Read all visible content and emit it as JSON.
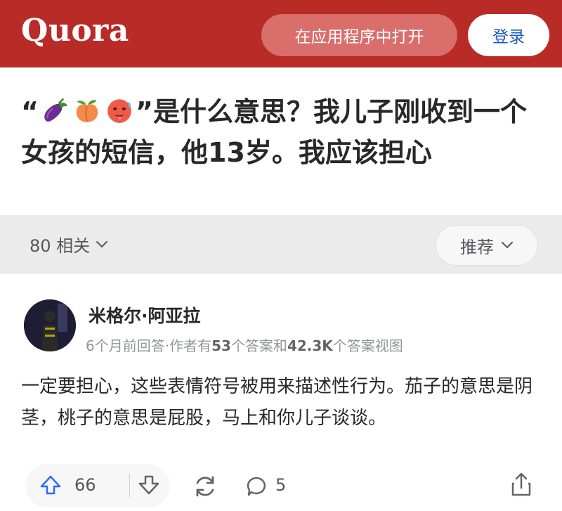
{
  "header": {
    "logo": "Quora",
    "open_in_app": "在应用程序中打开",
    "login": "登录",
    "brand_color": "#b92b27"
  },
  "question": {
    "open_quote": "“",
    "emojis": [
      "eggplant-emoji",
      "peach-emoji",
      "hot-face-emoji"
    ],
    "title_text": "”是什么意思？我儿子刚收到一个女孩的短信，他13岁。我应该担心"
  },
  "related_bar": {
    "related_label": "80 相关",
    "sort_label": "推荐"
  },
  "answer": {
    "author_name": "米格尔·阿亚拉",
    "meta_prefix": "6个月前回答·作者有",
    "answer_count": "53",
    "meta_mid": "个答案和",
    "view_count": "42.3K",
    "meta_suffix": "个答案视图",
    "body": "一定要担心，这些表情符号被用来描述性行为。茄子的意思是阴茎，桃子的意思是屁股，马上和你儿子谈谈。"
  },
  "actions": {
    "upvote_count": "66",
    "comment_count": "5",
    "icons": [
      "upvote-arrow-icon",
      "downvote-arrow-icon",
      "share-icon",
      "comment-icon",
      "upload-icon"
    ]
  }
}
